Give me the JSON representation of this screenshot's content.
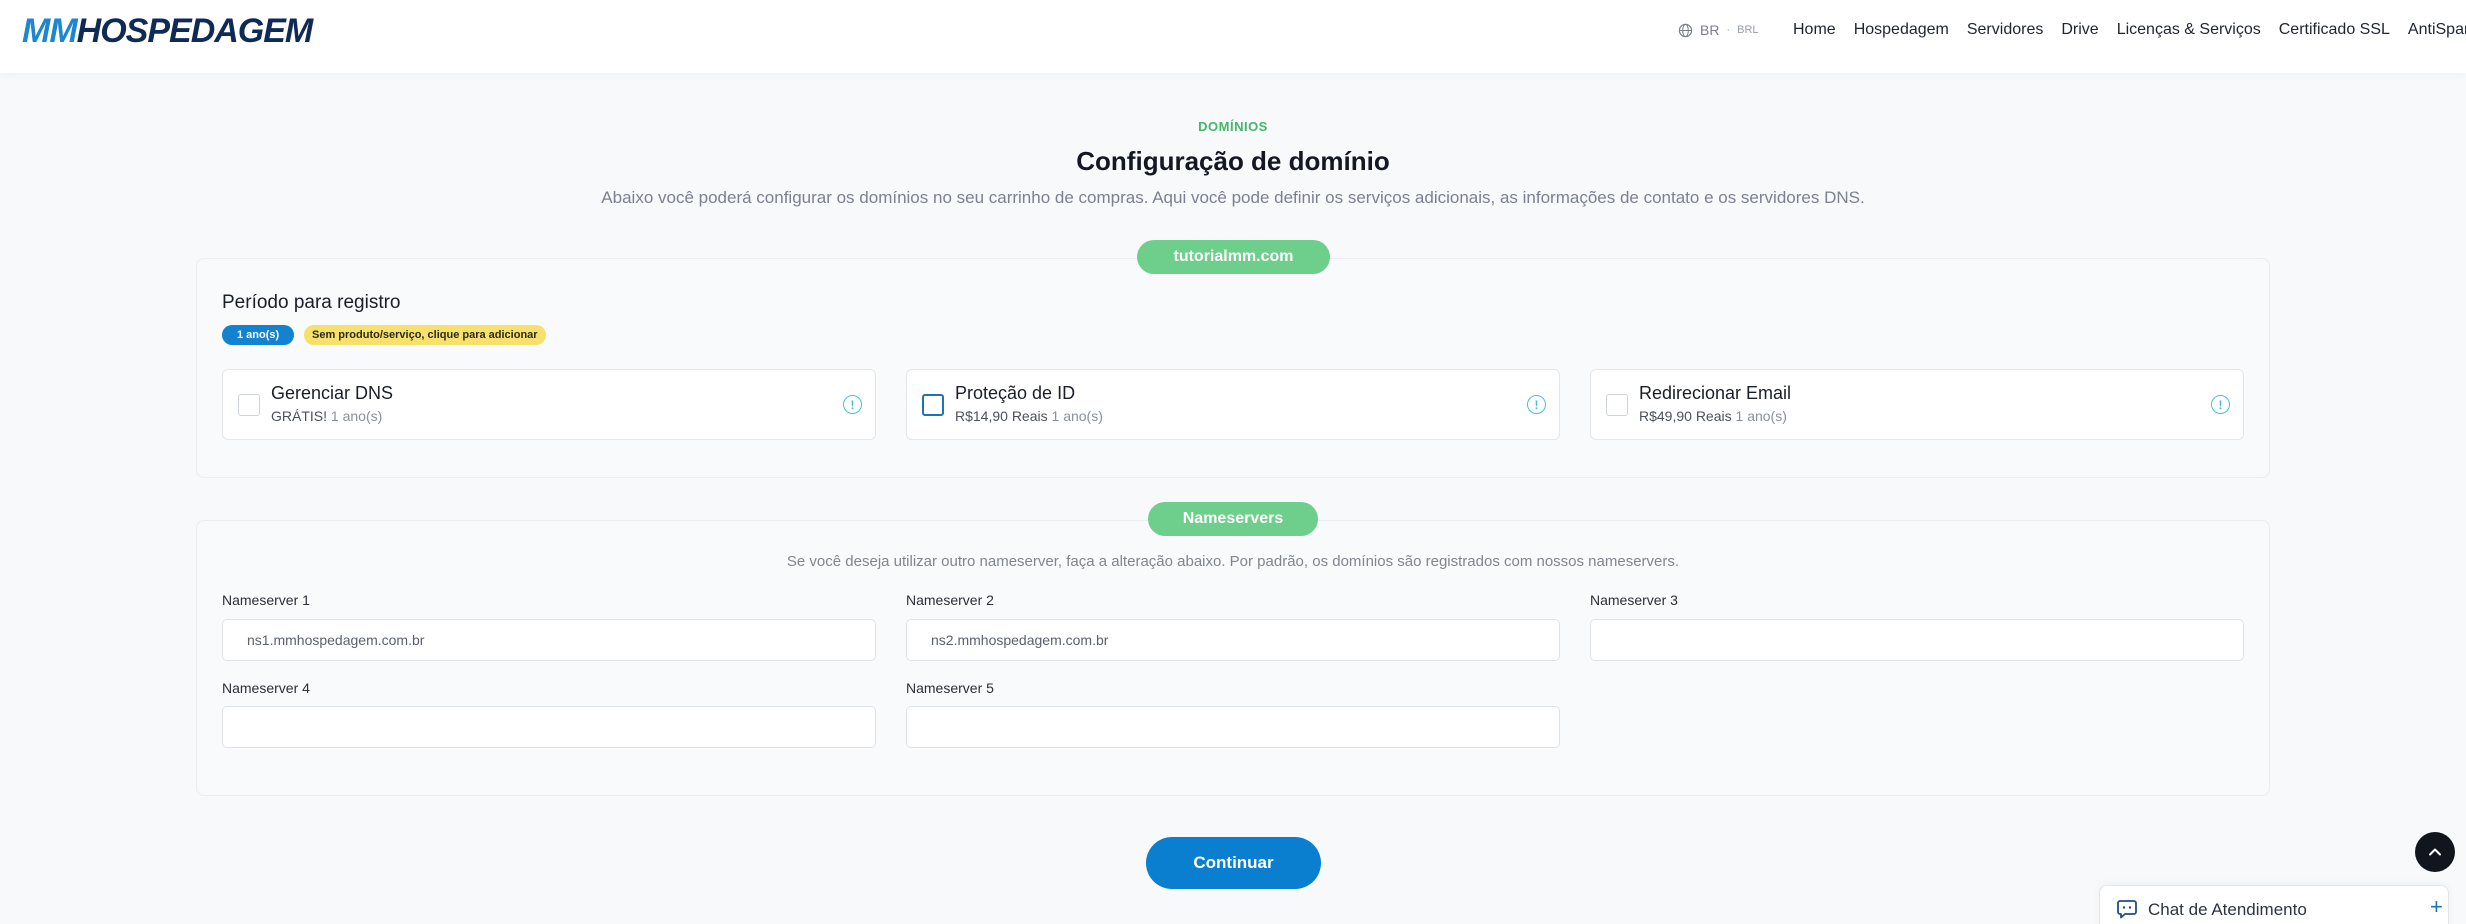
{
  "header": {
    "logo_mm": "MM",
    "logo_rest": "HOSPEDAGEM",
    "locale": "BR",
    "locale_separator": "·",
    "currency": "BRL",
    "nav": [
      "Home",
      "Hospedagem",
      "Servidores",
      "Drive",
      "Licenças & Serviços",
      "Certificado SSL",
      "AntiSpam"
    ]
  },
  "page": {
    "eyebrow": "DOMÍNIOS",
    "title": "Configuração de domínio",
    "subtitle": "Abaixo você poderá configurar os domínios no seu carrinho de compras. Aqui você pode definir os serviços adicionais, as informações de contato e os servidores DNS."
  },
  "domain": {
    "name": "tutorialmm.com",
    "period_title": "Período para registro",
    "period_badge": "1 ano(s)",
    "no_product_badge": "Sem produto/serviço, clique para adicionar",
    "addons": [
      {
        "name": "Gerenciar DNS",
        "price": "GRÁTIS!",
        "period": "1 ano(s)",
        "checked": false
      },
      {
        "name": "Proteção de ID",
        "price": "R$14,90 Reais",
        "period": "1 ano(s)",
        "checked": false
      },
      {
        "name": "Redirecionar Email",
        "price": "R$49,90 Reais",
        "period": "1 ano(s)",
        "checked": false
      }
    ],
    "info_symbol": "!"
  },
  "nameservers": {
    "title": "Nameservers",
    "description": "Se você deseja utilizar outro nameserver, faça a alteração abaixo. Por padrão, os domínios são registrados com nossos nameservers.",
    "fields": [
      {
        "label": "Nameserver 1",
        "value": "ns1.mmhospedagem.com.br"
      },
      {
        "label": "Nameserver 2",
        "value": "ns2.mmhospedagem.com.br"
      },
      {
        "label": "Nameserver 3",
        "value": ""
      },
      {
        "label": "Nameserver 4",
        "value": ""
      },
      {
        "label": "Nameserver 5",
        "value": ""
      }
    ]
  },
  "actions": {
    "continue": "Continuar"
  },
  "chat": {
    "label": "Chat de Atendimento",
    "plus": "+"
  },
  "colors": {
    "brand_blue": "#0a7fcf",
    "brand_navy": "#0f2a56",
    "accent_green": "#6dcf8b",
    "badge_yellow": "#f7e16a",
    "info_cyan": "#43c2d6"
  },
  "icons": [
    "globe-icon",
    "info-icon",
    "chevron-up-icon",
    "chat-bubble-icon",
    "plus-icon"
  ]
}
